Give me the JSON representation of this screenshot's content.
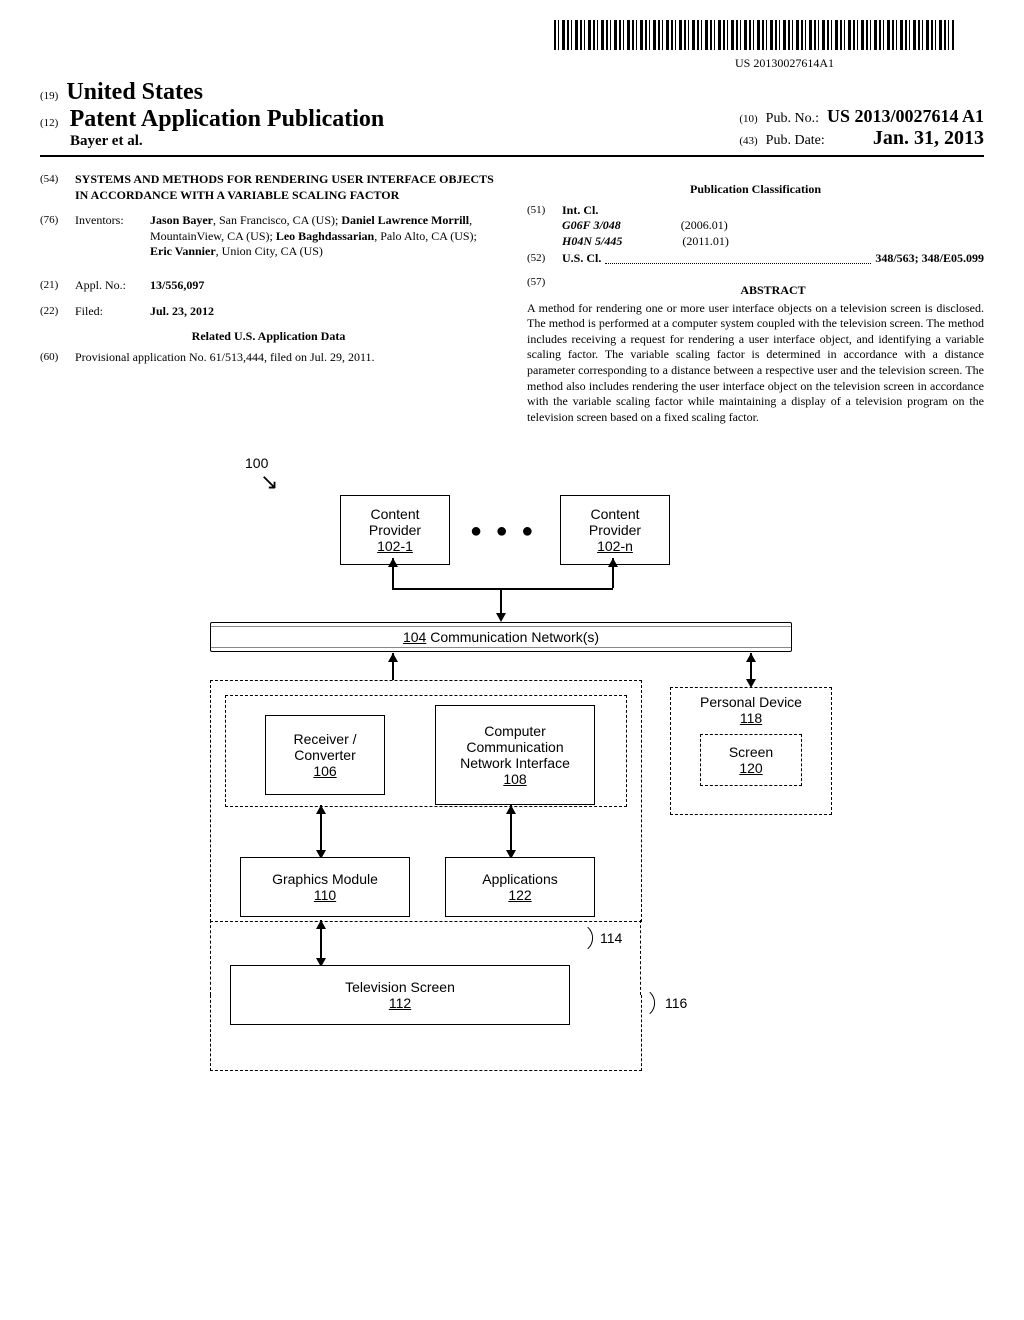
{
  "barcode_number": "US 20130027614A1",
  "header": {
    "code19": "(19)",
    "country": "United States",
    "code12": "(12)",
    "doc_type": "Patent Application Publication",
    "authors": "Bayer et al.",
    "code10": "(10)",
    "pub_no_label": "Pub. No.:",
    "pub_no_value": "US 2013/0027614 A1",
    "code43": "(43)",
    "pub_date_label": "Pub. Date:",
    "pub_date_value": "Jan. 31, 2013"
  },
  "left_col": {
    "code54": "(54)",
    "title": "SYSTEMS AND METHODS FOR RENDERING USER INTERFACE OBJECTS IN ACCORDANCE WITH A VARIABLE SCALING FACTOR",
    "code76": "(76)",
    "inventors_label": "Inventors:",
    "inventors": [
      {
        "name": "Jason Bayer",
        "loc": ", San Francisco, CA (US); "
      },
      {
        "name": "Daniel Lawrence Morrill",
        "loc": ", MountainView, CA (US); "
      },
      {
        "name": "Leo Baghdassarian",
        "loc": ", Palo Alto, CA (US); "
      },
      {
        "name": "Eric Vannier",
        "loc": ", Union City, CA (US)"
      }
    ],
    "code21": "(21)",
    "appl_no_label": "Appl. No.:",
    "appl_no_value": "13/556,097",
    "code22": "(22)",
    "filed_label": "Filed:",
    "filed_value": "Jul. 23, 2012",
    "related_heading": "Related U.S. Application Data",
    "code60": "(60)",
    "provisional": "Provisional application No. 61/513,444, filed on Jul. 29, 2011."
  },
  "right_col": {
    "pub_class_heading": "Publication Classification",
    "code51": "(51)",
    "int_cl_label": "Int. Cl.",
    "int_cl": [
      {
        "class": "G06F 3/048",
        "date": "(2006.01)"
      },
      {
        "class": "H04N 5/445",
        "date": "(2011.01)"
      }
    ],
    "code52": "(52)",
    "us_cl_label": "U.S. Cl.",
    "us_cl_value": "348/563; 348/E05.099",
    "code57": "(57)",
    "abstract_heading": "ABSTRACT",
    "abstract_text": "A method for rendering one or more user interface objects on a television screen is disclosed. The method is performed at a computer system coupled with the television screen. The method includes receiving a request for rendering a user interface object, and identifying a variable scaling factor. The variable scaling factor is determined in accordance with a distance parameter corresponding to a distance between a respective user and the television screen. The method also includes rendering the user interface object on the television screen in accordance with the variable scaling factor while maintaining a display of a television program on the television screen based on a fixed scaling factor."
  },
  "figure": {
    "ref_100": "100",
    "content_provider": "Content Provider",
    "cp_102_1": "102-1",
    "cp_102_n": "102-n",
    "network": "Communication Network(s)",
    "network_ref": "104",
    "receiver": "Receiver / Converter",
    "receiver_ref": "106",
    "ccni": "Computer Communication Network Interface",
    "ccni_ref": "108",
    "personal_device": "Personal Device",
    "pd_ref": "118",
    "screen": "Screen",
    "screen_ref": "120",
    "graphics": "Graphics Module",
    "graphics_ref": "110",
    "apps": "Applications",
    "apps_ref": "122",
    "tv": "Television Screen",
    "tv_ref": "112",
    "ref_114": "114",
    "ref_116": "116"
  }
}
